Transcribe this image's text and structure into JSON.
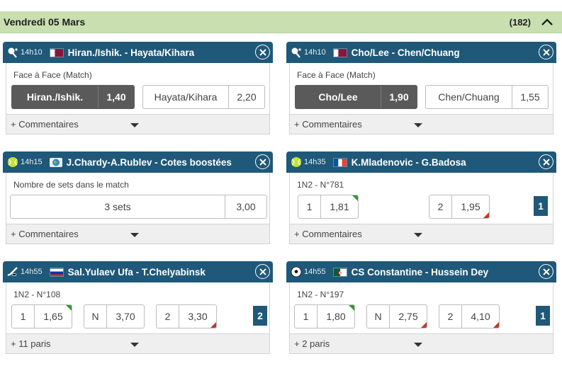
{
  "header": {
    "title": "Vendredi 05 Mars",
    "count": "(182)"
  },
  "cards": [
    {
      "sport": "table-tennis-icon",
      "time": "14h10",
      "flag": "qatar",
      "title": "Hiran./Ishik. - Hayata/Kihara",
      "market": "Face à Face (Match)",
      "odds": [
        {
          "label": "Hiran./Ishik.",
          "value": "1,40",
          "selected": true
        },
        {
          "label": "Hayata/Kihara",
          "value": "2,20",
          "selected": false
        }
      ],
      "footer": "+ Commentaires"
    },
    {
      "sport": "table-tennis-icon",
      "time": "14h10",
      "flag": "qatar",
      "title": "Cho/Lee - Chen/Chuang",
      "market": "Face à Face (Match)",
      "odds": [
        {
          "label": "Cho/Lee",
          "value": "1,90",
          "selected": true
        },
        {
          "label": "Chen/Chuang",
          "value": "1,55",
          "selected": false
        }
      ],
      "footer": "+ Commentaires"
    },
    {
      "sport": "tennis-ball-icon",
      "time": "14h15",
      "flag": "world",
      "title": "J.Chardy-A.Rublev - Cotes boostées",
      "market": "Nombre de sets dans le match",
      "odds": [
        {
          "label": "3 sets",
          "value": "3,00"
        }
      ],
      "footer": "+ Commentaires"
    },
    {
      "sport": "tennis-ball-icon",
      "time": "14h35",
      "flag": "france",
      "title": "K.Mladenovic - G.Badosa",
      "market": "1N2 - N°781",
      "odds": [
        {
          "label": "1",
          "value": "1,81",
          "trend": "up"
        },
        {
          "label": "2",
          "value": "1,95",
          "trend": "down"
        }
      ],
      "badge": "1",
      "footer": "+ Commentaires"
    },
    {
      "sport": "hockey-puck-icon",
      "time": "14h55",
      "flag": "russia",
      "title": "Sal.Yulaev Ufa - T.Chelyabinsk",
      "market": "1N2 - N°108",
      "odds": [
        {
          "label": "1",
          "value": "1,65",
          "trend": "up"
        },
        {
          "label": "N",
          "value": "3,70"
        },
        {
          "label": "2",
          "value": "3,30",
          "trend": "down"
        }
      ],
      "badge": "2",
      "footer": "+ 11 paris"
    },
    {
      "sport": "soccer-ball-icon",
      "time": "14h55",
      "flag": "algeria",
      "title": "CS Constantine - Hussein Dey",
      "market": "1N2 - N°197",
      "odds": [
        {
          "label": "1",
          "value": "1,80",
          "trend": "up"
        },
        {
          "label": "N",
          "value": "2,75",
          "trend": "down"
        },
        {
          "label": "2",
          "value": "4,10",
          "trend": "down"
        }
      ],
      "badge": "1",
      "footer": "+ 2 paris"
    }
  ],
  "colors": {
    "header_bg": "#c9dfb0",
    "card_head": "#1f5878",
    "selected": "#5a5a5a",
    "up": "#2f9a2f",
    "down": "#c0392b"
  }
}
